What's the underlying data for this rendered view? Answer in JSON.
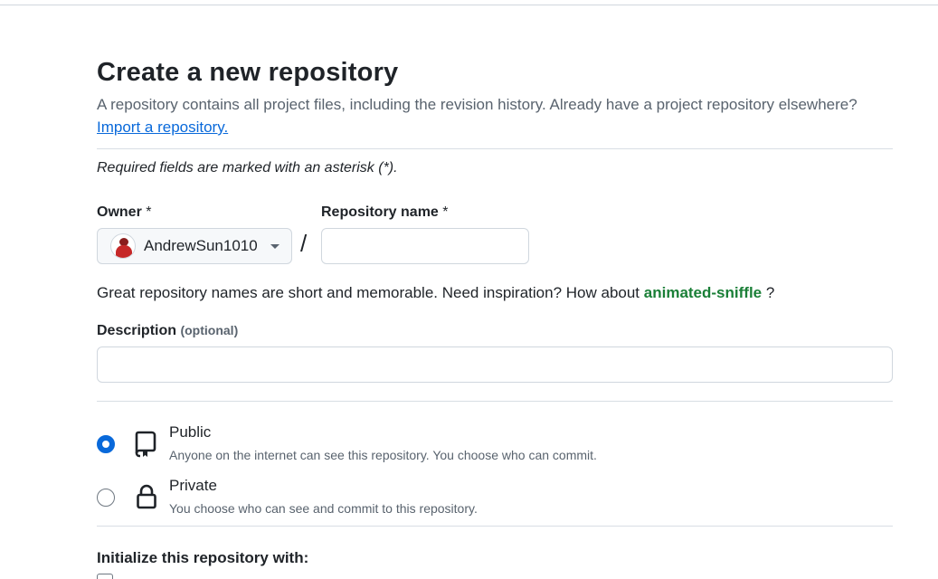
{
  "header": {
    "title": "Create a new repository",
    "subtitle": "A repository contains all project files, including the revision history. Already have a project repository elsewhere?",
    "import_link": "Import a repository."
  },
  "form": {
    "required_note": "Required fields are marked with an asterisk (*).",
    "owner": {
      "label": "Owner",
      "asterisk": "*",
      "selected": "AndrewSun1010",
      "avatar_icon": "user-avatar"
    },
    "separator": "/",
    "repository_name": {
      "label": "Repository name",
      "asterisk": "*",
      "value": "",
      "placeholder": ""
    },
    "name_hint": {
      "prefix": "Great repository names are short and memorable. Need inspiration? How about",
      "suggestion": "animated-sniffle",
      "suffix": "?"
    },
    "description": {
      "label": "Description",
      "optional": "(optional)",
      "value": "",
      "placeholder": ""
    },
    "visibility": {
      "options": [
        {
          "title": "Public",
          "description": "Anyone on the internet can see this repository. You choose who can commit.",
          "icon": "repo-icon",
          "checked": true
        },
        {
          "title": "Private",
          "description": "You choose who can see and commit to this repository.",
          "icon": "lock-icon",
          "checked": false
        }
      ]
    },
    "initialize": {
      "heading": "Initialize this repository with:"
    }
  },
  "colors": {
    "accent": "#0969da",
    "success": "#1a7f37",
    "muted": "#59636e",
    "border": "#d0d7de"
  }
}
